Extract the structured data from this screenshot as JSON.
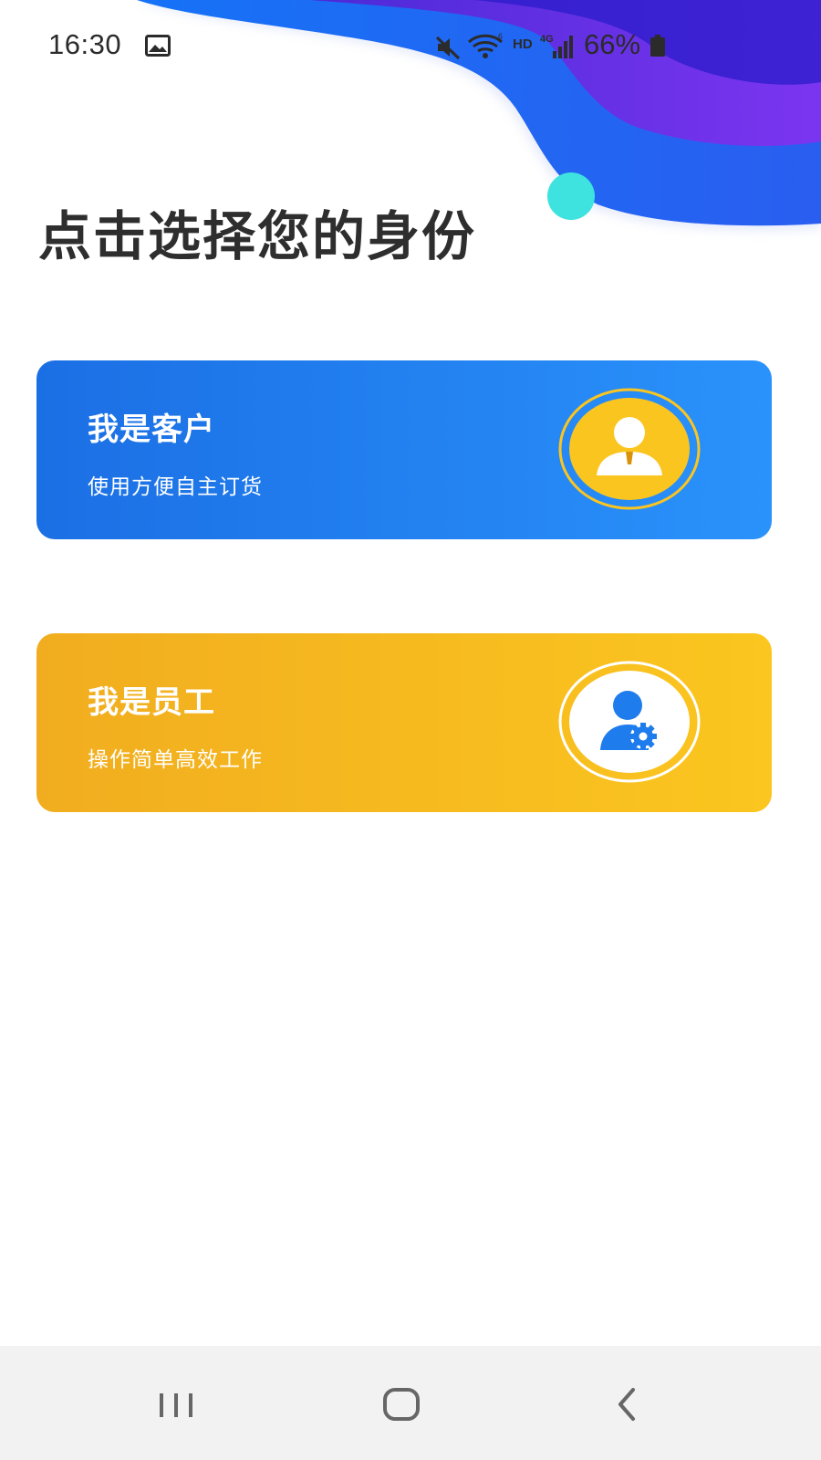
{
  "status_bar": {
    "time": "16:30",
    "hd": "HD",
    "battery": "66%",
    "icons": [
      "gallery-icon",
      "mute-icon",
      "wifi-icon",
      "signal-icon",
      "battery-icon"
    ]
  },
  "page": {
    "title": "点击选择您的身份"
  },
  "cards": {
    "customer": {
      "title": "我是客户",
      "subtitle": "使用方便自主订货",
      "icon": "customer-avatar-icon",
      "color": "#2287f0"
    },
    "employee": {
      "title": "我是员工",
      "subtitle": "操作简单高效工作",
      "icon": "employee-settings-icon",
      "color": "#f7b81f"
    }
  },
  "nav_bar": {
    "buttons": [
      "recents-icon",
      "home-icon",
      "back-icon"
    ]
  },
  "colors": {
    "accent_blue": "#1f7cec",
    "accent_yellow": "#fbc520",
    "wave_purple": "#5a2be8",
    "wave_cyan": "#3ee3df"
  }
}
